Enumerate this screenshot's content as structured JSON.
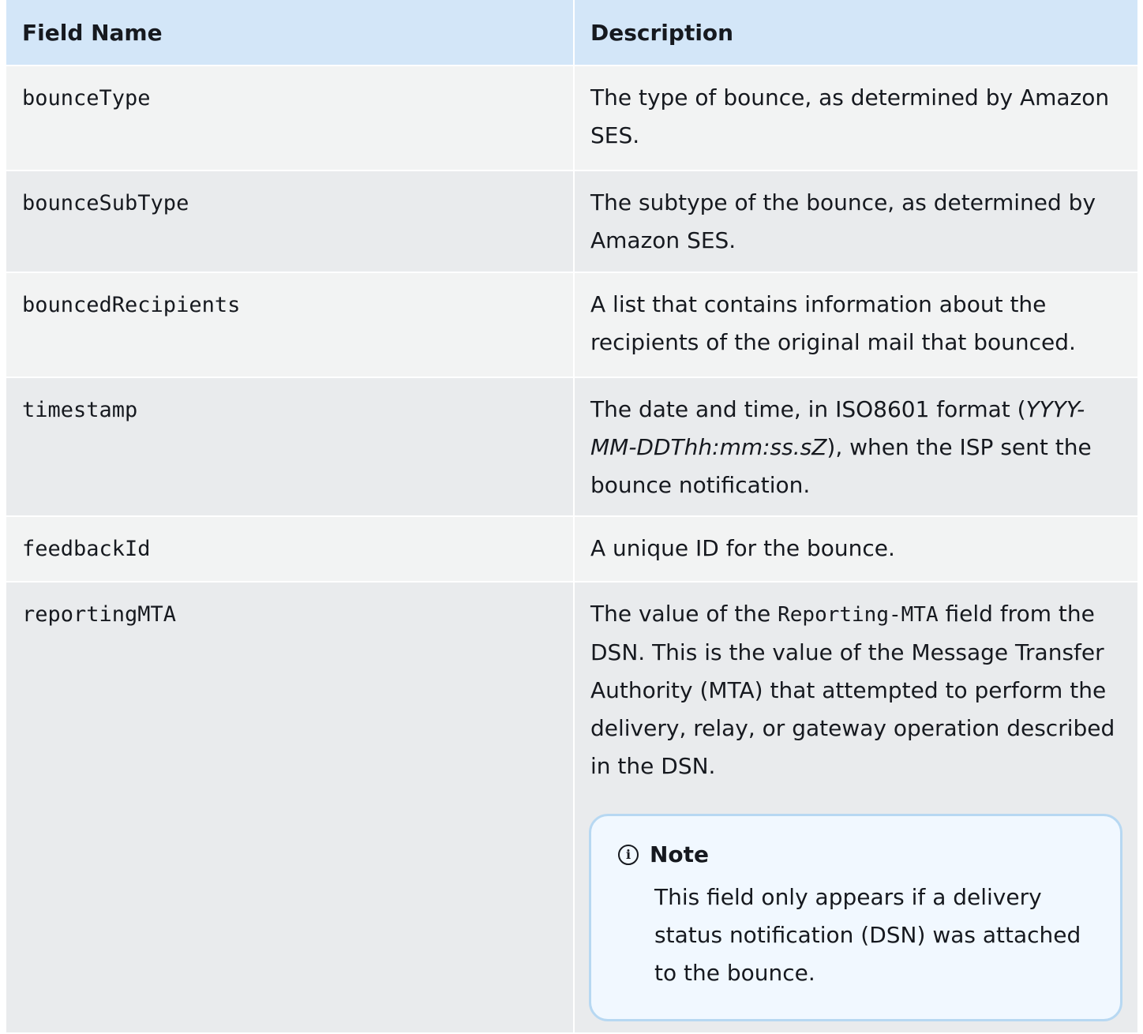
{
  "table": {
    "headers": {
      "field_name": "Field Name",
      "description": "Description"
    },
    "rows": [
      {
        "field": "bounceType",
        "description": "The type of bounce, as determined by Amazon SES."
      },
      {
        "field": "bounceSubType",
        "description": "The subtype of the bounce, as determined by Amazon SES."
      },
      {
        "field": "bouncedRecipients",
        "description": "A list that contains information about the recipients of the original mail that bounced."
      },
      {
        "field": "timestamp",
        "description_pre": "The date and time, in ISO8601 format (",
        "description_em": "YYYY-MM-DDThh:mm:ss.sZ",
        "description_post": "), when the ISP sent the bounce notification."
      },
      {
        "field": "feedbackId",
        "description": "A unique ID for the bounce."
      },
      {
        "field": "reportingMTA",
        "description_pre": "The value of the ",
        "description_code": "Reporting-MTA",
        "description_post": "  field from the DSN. This is the value of the Message Transfer Authority (MTA) that attempted to perform the delivery, relay, or gateway operation described in the DSN.",
        "note": {
          "icon": "info-icon",
          "title": "Note",
          "body": "This field only appears if a delivery status notification (DSN) was attached to the bounce."
        }
      }
    ]
  },
  "colors": {
    "header_bg": "#d3e6f8",
    "row_light": "#f2f3f3",
    "row_dark": "#e9ebed",
    "note_bg": "#f1f8ff",
    "note_border": "#b7d8f2"
  }
}
